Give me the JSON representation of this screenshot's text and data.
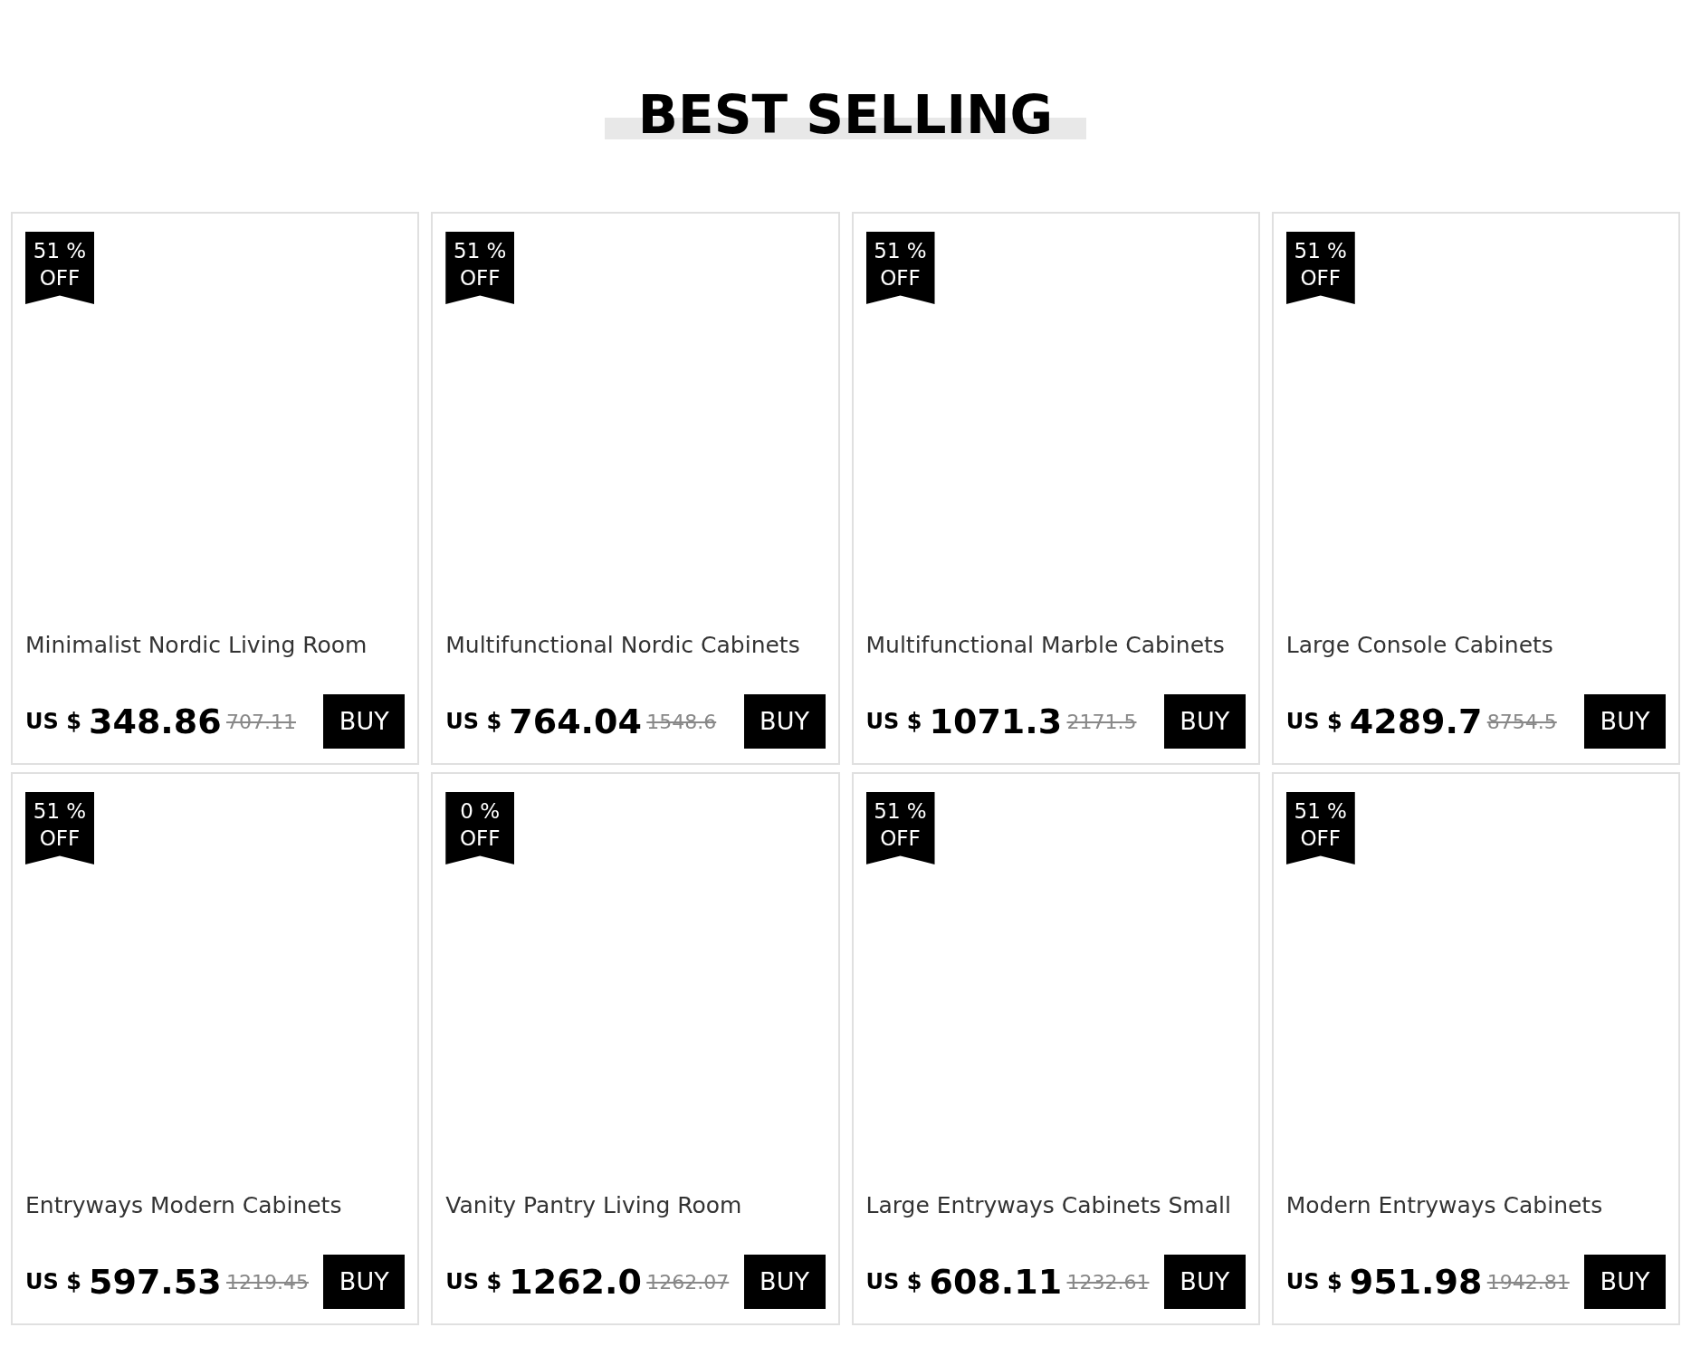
{
  "heading": "BEST SELLING",
  "products": [
    {
      "discount": "51 %",
      "off": "OFF",
      "name": "Minimalist Nordic Living Room",
      "currency": "US $",
      "price": "348.86",
      "old_price": "707.11",
      "button": "BUY"
    },
    {
      "discount": "51 %",
      "off": "OFF",
      "name": "Multifunctional Nordic Cabinets",
      "currency": "US $",
      "price": "764.04",
      "old_price": "1548.6",
      "button": "BUY"
    },
    {
      "discount": "51 %",
      "off": "OFF",
      "name": "Multifunctional Marble Cabinets",
      "currency": "US $",
      "price": "1071.3",
      "old_price": "2171.5",
      "button": "BUY"
    },
    {
      "discount": "51 %",
      "off": "OFF",
      "name": "Large Console Cabinets",
      "currency": "US $",
      "price": "4289.7",
      "old_price": "8754.5",
      "button": "BUY"
    },
    {
      "discount": "51 %",
      "off": "OFF",
      "name": "Entryways Modern Cabinets",
      "currency": "US $",
      "price": "597.53",
      "old_price": "1219.45",
      "button": "BUY"
    },
    {
      "discount": "0 %",
      "off": "OFF",
      "name": "Vanity Pantry Living Room",
      "currency": "US $",
      "price": "1262.0",
      "old_price": "1262.07",
      "button": "BUY"
    },
    {
      "discount": "51 %",
      "off": "OFF",
      "name": "Large Entryways Cabinets Small",
      "currency": "US $",
      "price": "608.11",
      "old_price": "1232.61",
      "button": "BUY"
    },
    {
      "discount": "51 %",
      "off": "OFF",
      "name": "Modern Entryways Cabinets",
      "currency": "US $",
      "price": "951.98",
      "old_price": "1942.81",
      "button": "BUY"
    }
  ]
}
